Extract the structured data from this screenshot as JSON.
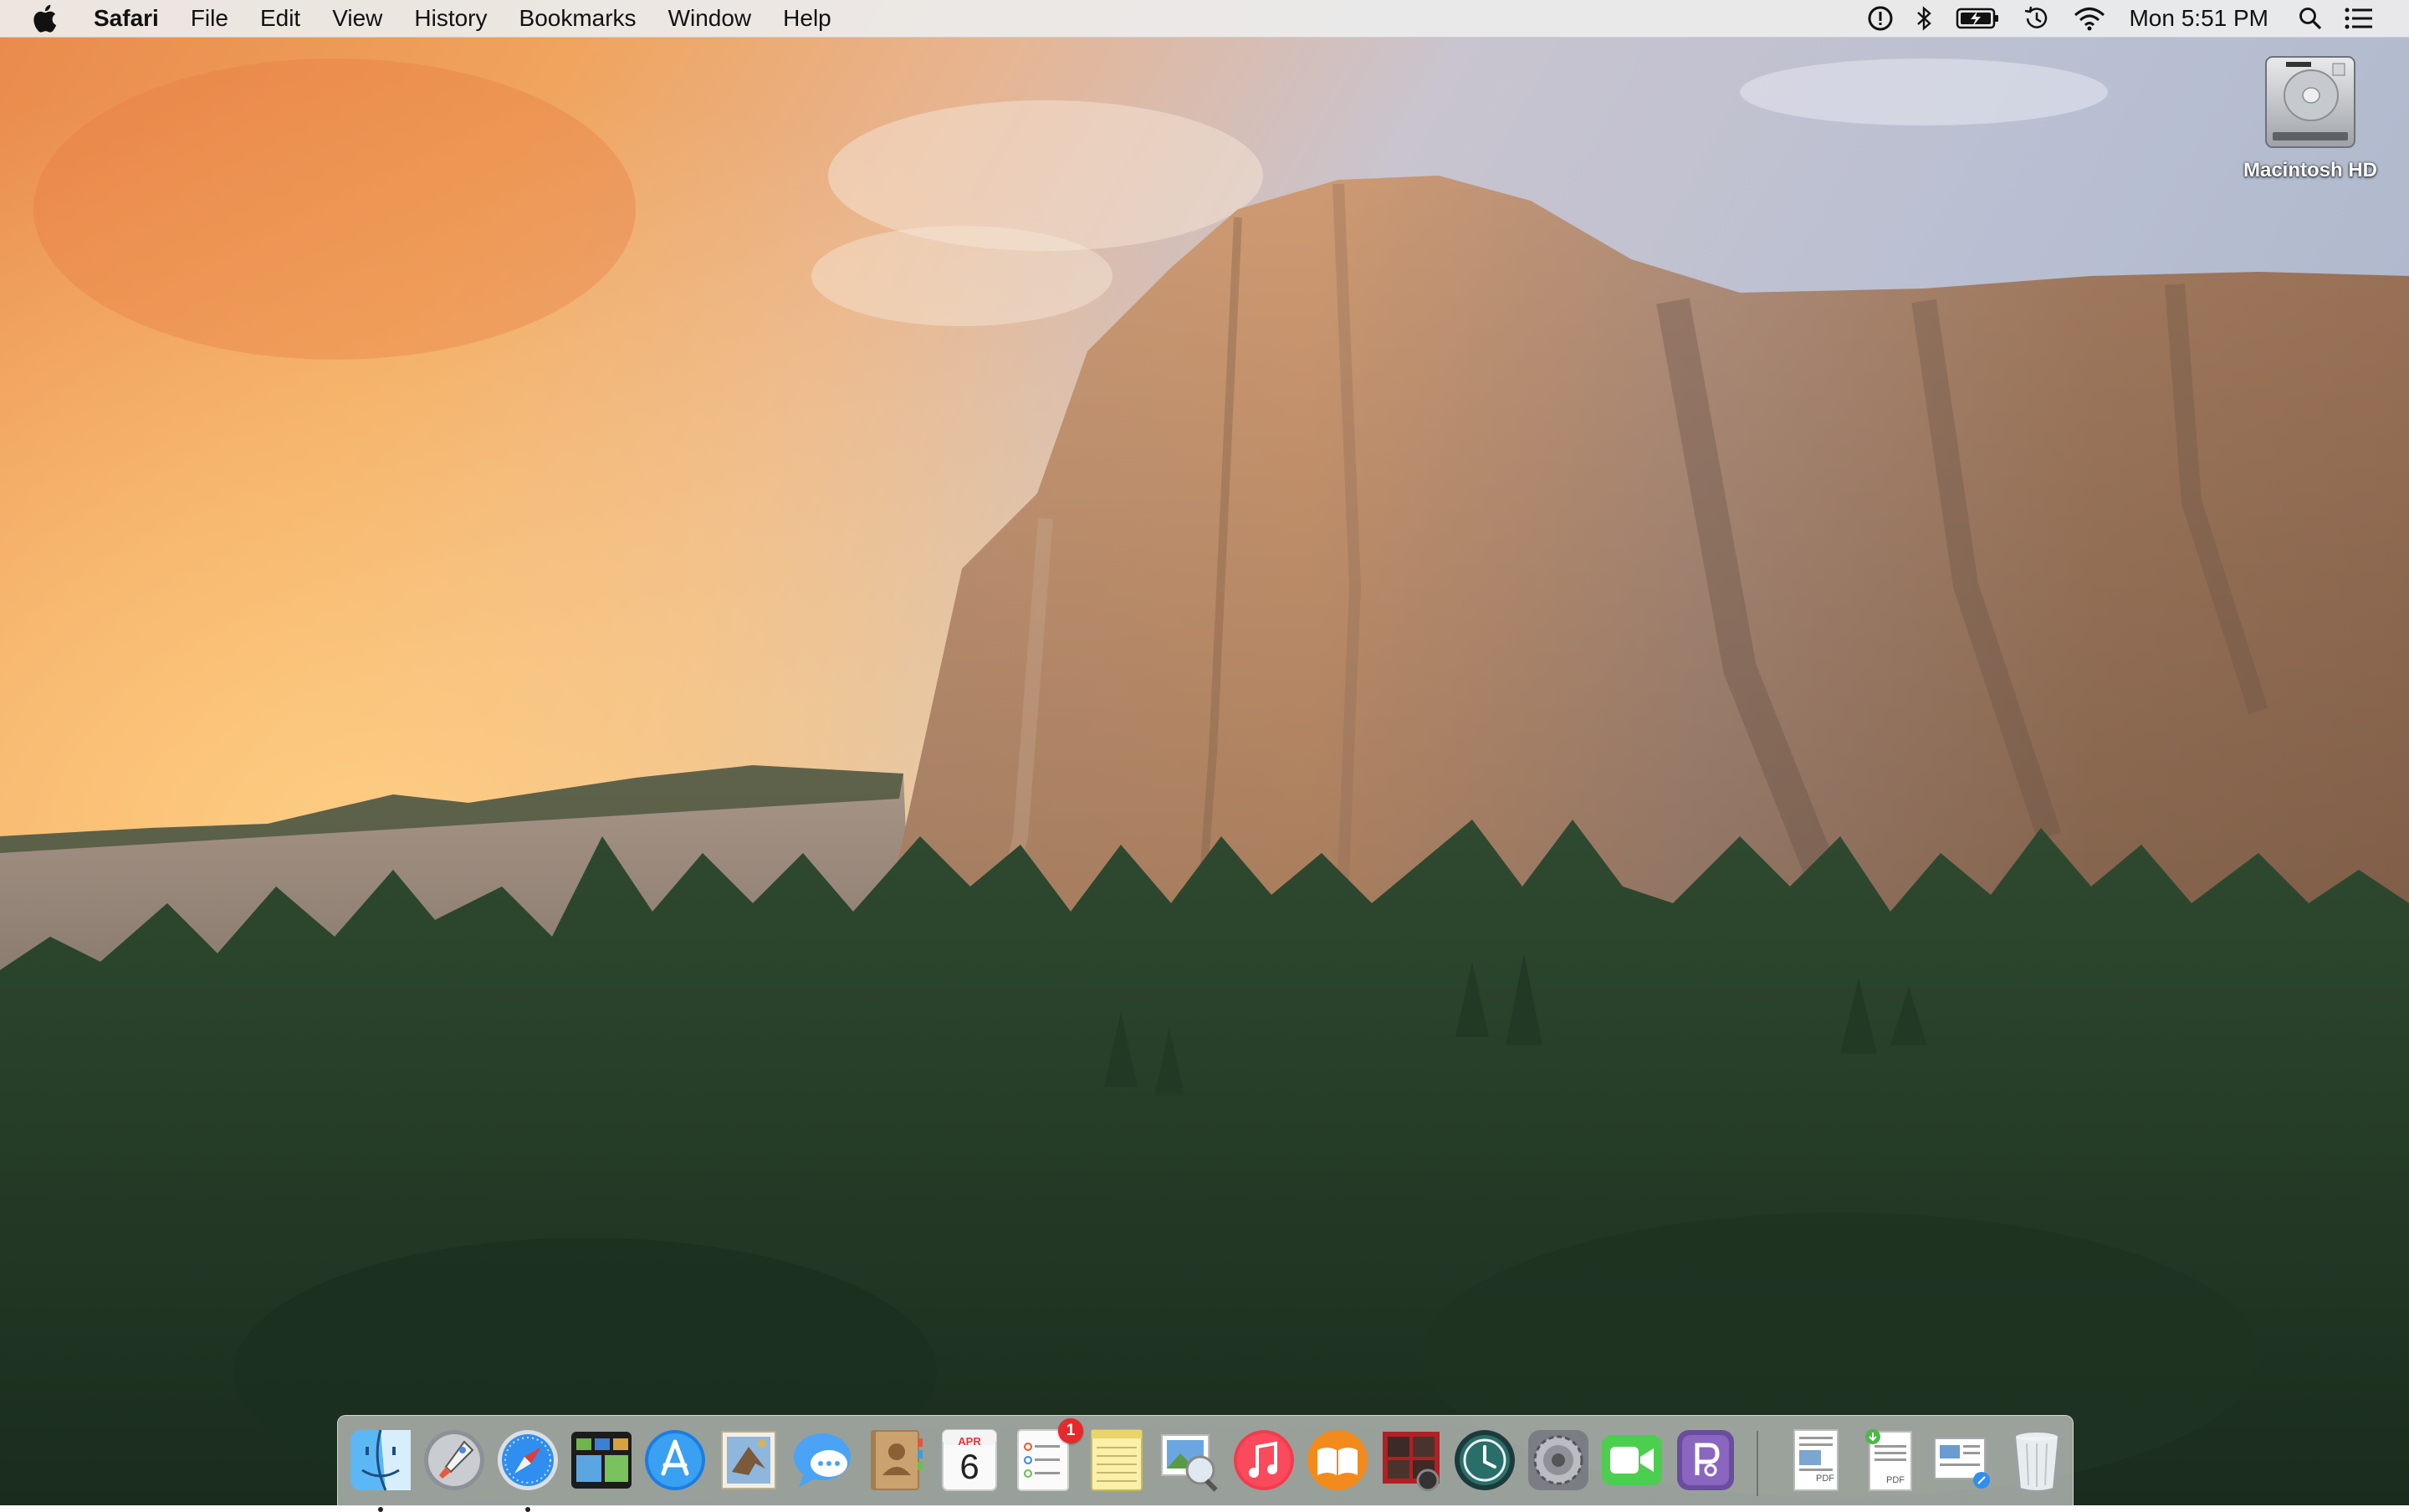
{
  "menubar": {
    "app_name": "Safari",
    "items": [
      "File",
      "Edit",
      "View",
      "History",
      "Bookmarks",
      "Window",
      "Help"
    ],
    "status_icons": [
      "alert-circle-icon",
      "bluetooth-icon",
      "battery-icon",
      "time-machine-icon",
      "wifi-icon"
    ],
    "clock": "Mon 5:51 PM"
  },
  "desktop": {
    "icons": [
      {
        "label": "Macintosh HD",
        "icon": "hard-drive-icon"
      }
    ]
  },
  "dock": {
    "apps": [
      {
        "name": "Finder",
        "icon": "finder-icon",
        "running": true
      },
      {
        "name": "Launchpad",
        "icon": "launchpad-icon",
        "running": false
      },
      {
        "name": "Safari",
        "icon": "safari-icon",
        "running": true
      },
      {
        "name": "Mission Control",
        "icon": "mission-control-icon",
        "running": false
      },
      {
        "name": "App Store",
        "icon": "app-store-icon",
        "running": false
      },
      {
        "name": "Mail",
        "icon": "mail-icon",
        "running": false
      },
      {
        "name": "Messages",
        "icon": "messages-icon",
        "running": false
      },
      {
        "name": "Contacts",
        "icon": "contacts-icon",
        "running": false
      },
      {
        "name": "Calendar",
        "icon": "calendar-icon",
        "running": false,
        "month": "APR",
        "day": "6"
      },
      {
        "name": "Reminders",
        "icon": "reminders-icon",
        "running": false,
        "badge": "1"
      },
      {
        "name": "Notes",
        "icon": "notes-icon",
        "running": false
      },
      {
        "name": "Preview",
        "icon": "preview-icon",
        "running": false
      },
      {
        "name": "iTunes",
        "icon": "itunes-icon",
        "running": false
      },
      {
        "name": "iBooks",
        "icon": "ibooks-icon",
        "running": false
      },
      {
        "name": "Photo Booth",
        "icon": "photo-booth-icon",
        "running": false
      },
      {
        "name": "Time Machine",
        "icon": "time-machine-app-icon",
        "running": false
      },
      {
        "name": "System Preferences",
        "icon": "system-preferences-icon",
        "running": false
      },
      {
        "name": "FaceTime",
        "icon": "facetime-icon",
        "running": false
      },
      {
        "name": "Screen Sharing",
        "icon": "screen-sharing-icon",
        "running": false
      }
    ],
    "documents": [
      {
        "name": "PDF document",
        "icon": "pdf-document-icon",
        "text": "PDF"
      },
      {
        "name": "PDF download",
        "icon": "pdf-download-icon",
        "text": "PDF"
      },
      {
        "name": "Downloads stack",
        "icon": "downloads-stack-icon"
      },
      {
        "name": "Trash",
        "icon": "trash-icon"
      }
    ]
  },
  "colors": {
    "menubar_bg": "#ececec",
    "badge": "#e8292c",
    "sky_warm": "#f0944a",
    "sky_cool": "#b9c0d3",
    "rock": "#b98a66",
    "forest": "#27402a"
  }
}
